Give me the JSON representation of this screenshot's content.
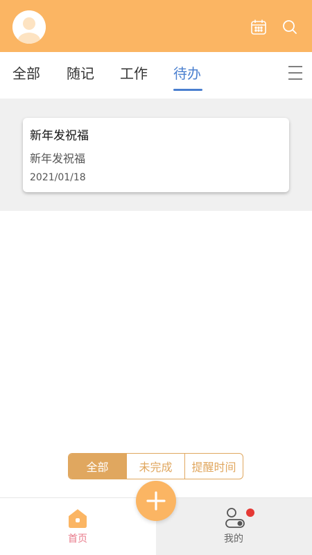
{
  "colors": {
    "header": "#fbb563",
    "active_tab": "#4a7fcf",
    "filter_accent": "#e0a75f",
    "home_label": "#e87a8a",
    "badge": "#e53935"
  },
  "header": {
    "avatar_icon": "user-avatar-icon",
    "calendar_icon": "calendar-icon",
    "search_icon": "search-icon"
  },
  "tabs": [
    {
      "label": "全部",
      "active": false
    },
    {
      "label": "随记",
      "active": false
    },
    {
      "label": "工作",
      "active": false
    },
    {
      "label": "待办",
      "active": true
    }
  ],
  "menu_icon": "hamburger-menu-icon",
  "notes": [
    {
      "title": "新年发祝福",
      "content": "新年发祝福",
      "date": "2021/01/18"
    }
  ],
  "filter": {
    "options": [
      "全部",
      "未完成",
      "提醒时间"
    ],
    "selected": "全部"
  },
  "fab_icon": "plus-icon",
  "bottom_nav": [
    {
      "label": "首页",
      "icon": "home-icon",
      "active": true
    },
    {
      "label": "我的",
      "icon": "profile-icon",
      "active": false,
      "badge": true
    }
  ]
}
